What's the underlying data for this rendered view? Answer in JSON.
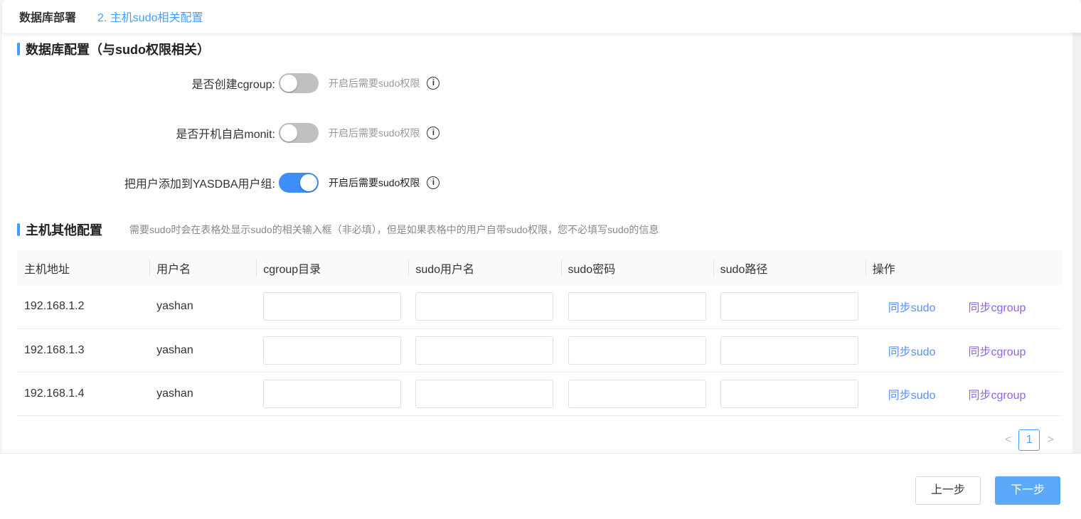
{
  "header": {
    "app": "数据库部署",
    "step": "2. 主机sudo相关配置"
  },
  "db_section": {
    "title": "数据库配置（与sudo权限相关）",
    "rows": [
      {
        "label": "是否创建cgroup:",
        "enabled": false,
        "hint": "开启后需要sudo权限"
      },
      {
        "label": "是否开机自启monit:",
        "enabled": false,
        "hint": "开启后需要sudo权限"
      },
      {
        "label": "把用户添加到YASDBA用户组:",
        "enabled": true,
        "hint": "开启后需要sudo权限"
      }
    ]
  },
  "host_section": {
    "title": "主机其他配置",
    "note": "需要sudo时会在表格处显示sudo的相关输入框（非必填），但是如果表格中的用户自带sudo权限，您不必填写sudo的信息"
  },
  "table": {
    "headers": [
      "主机地址",
      "用户名",
      "cgroup目录",
      "sudo用户名",
      "sudo密码",
      "sudo路径",
      "操作"
    ],
    "rows": [
      {
        "host": "192.168.1.2",
        "user": "yashan",
        "cgroup": "",
        "sudo_user": "",
        "sudo_pwd": "",
        "sudo_path": "",
        "sync_sudo": "同步sudo",
        "sync_cgroup": "同步cgroup"
      },
      {
        "host": "192.168.1.3",
        "user": "yashan",
        "cgroup": "",
        "sudo_user": "",
        "sudo_pwd": "",
        "sudo_path": "",
        "sync_sudo": "同步sudo",
        "sync_cgroup": "同步cgroup"
      },
      {
        "host": "192.168.1.4",
        "user": "yashan",
        "cgroup": "",
        "sudo_user": "",
        "sudo_pwd": "",
        "sudo_path": "",
        "sync_sudo": "同步sudo",
        "sync_cgroup": "同步cgroup"
      }
    ]
  },
  "pagination": {
    "prev": "<",
    "page": "1",
    "next": ">"
  },
  "footer": {
    "prev": "上一步",
    "next": "下一步"
  }
}
